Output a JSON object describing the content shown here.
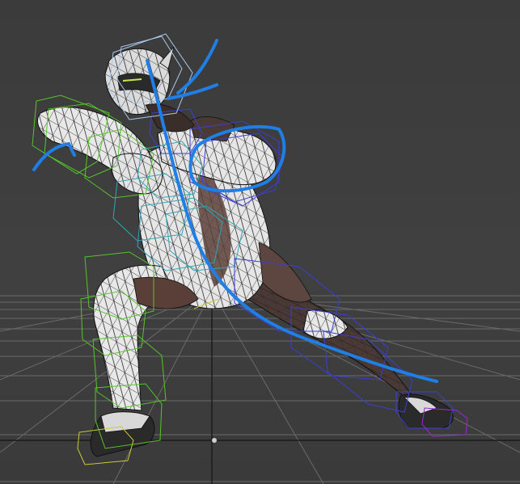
{
  "viewport": {
    "background": "#3b3b3b",
    "grid_color": "#6a6a6a",
    "grid_axis_color": "#1a1a1a"
  },
  "scene": {
    "mesh_fill_light": "#e8e8e8",
    "mesh_fill_dark": "#4a3a36",
    "mesh_wire_color": "#111111",
    "bone_box_green": "#55c52a",
    "bone_box_cyan": "#2fa7b6",
    "bone_box_blue": "#3a3fd6",
    "bone_box_purple": "#9a2bd0",
    "bone_box_yellow": "#c9c93a",
    "bone_box_lightblue": "#a8c8e8"
  },
  "annotation": {
    "stroke_color": "#1f7fe6"
  }
}
